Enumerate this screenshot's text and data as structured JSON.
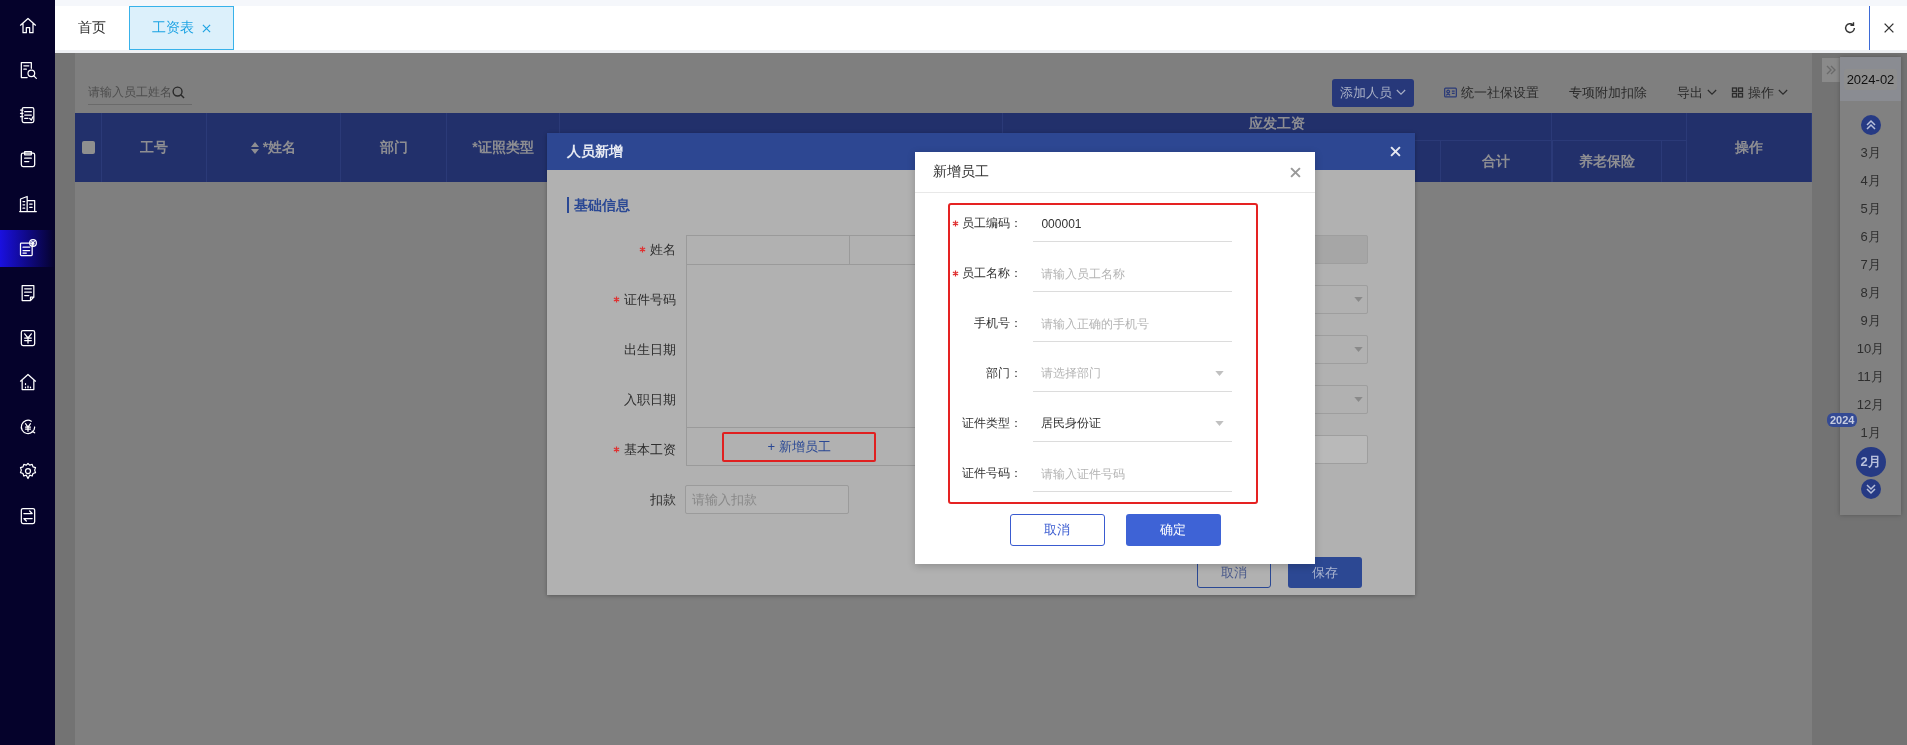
{
  "sidebar": {
    "items": [
      {
        "kind": "home",
        "selected": false
      },
      {
        "kind": "search-doc",
        "selected": false
      },
      {
        "kind": "checklist",
        "selected": false
      },
      {
        "kind": "clipboard",
        "selected": false
      },
      {
        "kind": "buildings",
        "selected": false
      },
      {
        "kind": "doc-yen",
        "selected": true
      },
      {
        "kind": "document",
        "selected": false
      },
      {
        "kind": "yen-box",
        "selected": false
      },
      {
        "kind": "house-chart",
        "selected": false
      },
      {
        "kind": "yen-cycle",
        "selected": false
      },
      {
        "kind": "gear",
        "selected": false
      },
      {
        "kind": "transfer",
        "selected": false
      }
    ]
  },
  "tabs": [
    {
      "label": "首页",
      "selected": false,
      "closable": false
    },
    {
      "label": "工资表",
      "selected": true,
      "closable": true
    }
  ],
  "toolbar": {
    "search": {
      "placeholder": "请输入员工姓名"
    },
    "actions": [
      {
        "label": "添加人员",
        "kind": "primary-dropdown"
      },
      {
        "label": "统一社保设置",
        "kind": "icon"
      },
      {
        "label": "专项附加扣除",
        "kind": "plain"
      },
      {
        "label": "导出",
        "kind": "dropdown"
      },
      {
        "label": "操作",
        "kind": "icon-dropdown"
      }
    ]
  },
  "table": {
    "columns": [
      {
        "kind": "checkbox",
        "checked": false
      },
      {
        "kind": "text",
        "label": "工号"
      },
      {
        "kind": "sort",
        "label": "*姓名"
      },
      {
        "kind": "text",
        "label": "部门"
      },
      {
        "kind": "text",
        "label": "*证照类型"
      },
      {
        "kind": "group",
        "label": "应发工资",
        "children": [
          "合计"
        ]
      },
      {
        "kind": "group",
        "children": [
          "养老保险"
        ]
      },
      {
        "kind": "text",
        "label": "操作"
      }
    ]
  },
  "calendar": {
    "current": "2024-02",
    "months": [
      {
        "label": "3月",
        "selected": false
      },
      {
        "label": "4月",
        "selected": false
      },
      {
        "label": "5月",
        "selected": false
      },
      {
        "label": "6月",
        "selected": false
      },
      {
        "label": "7月",
        "selected": false
      },
      {
        "label": "8月",
        "selected": false
      },
      {
        "label": "9月",
        "selected": false
      },
      {
        "label": "10月",
        "selected": false
      },
      {
        "label": "11月",
        "selected": false
      },
      {
        "label": "12月",
        "selected": false
      },
      {
        "label": "1月",
        "selected": false,
        "year_badge": "2024"
      },
      {
        "label": "2月",
        "selected": true
      }
    ]
  },
  "person_dialog": {
    "title": "人员新增",
    "section": "基础信息",
    "fields": [
      {
        "label": "姓名",
        "required": true
      },
      {
        "label": "证件号码",
        "required": true
      },
      {
        "label": "出生日期",
        "required": false
      },
      {
        "label": "入职日期",
        "required": false
      },
      {
        "label": "基本工资",
        "required": true
      },
      {
        "label": "扣款",
        "required": false,
        "placeholder": "请输入扣款"
      }
    ],
    "right_fields": [
      {
        "kind": "filled"
      },
      {
        "kind": "select"
      },
      {
        "kind": "select"
      },
      {
        "kind": "select"
      },
      {
        "kind": "input"
      }
    ],
    "dropdown": {
      "add_button": "+ 新增员工",
      "highlighted": true
    },
    "buttons": [
      {
        "label": "取消",
        "kind": "secondary"
      },
      {
        "label": "保存",
        "kind": "primary"
      }
    ]
  },
  "employee_dialog": {
    "title": "新增员工",
    "highlighted": true,
    "fields": [
      {
        "label": "员工编码：",
        "required": true,
        "kind": "input",
        "value": "000001"
      },
      {
        "label": "员工名称：",
        "required": true,
        "kind": "input",
        "placeholder": "请输入员工名称"
      },
      {
        "label": "手机号：",
        "required": false,
        "kind": "input",
        "placeholder": "请输入正确的手机号"
      },
      {
        "label": "部门：",
        "required": false,
        "kind": "select",
        "placeholder": "请选择部门"
      },
      {
        "label": "证件类型：",
        "required": false,
        "kind": "select",
        "value": "居民身份证"
      },
      {
        "label": "证件号码：",
        "required": false,
        "kind": "input",
        "placeholder": "请输入证件号码"
      }
    ],
    "buttons": [
      {
        "label": "取消",
        "kind": "secondary"
      },
      {
        "label": "确定",
        "kind": "primary"
      }
    ]
  }
}
